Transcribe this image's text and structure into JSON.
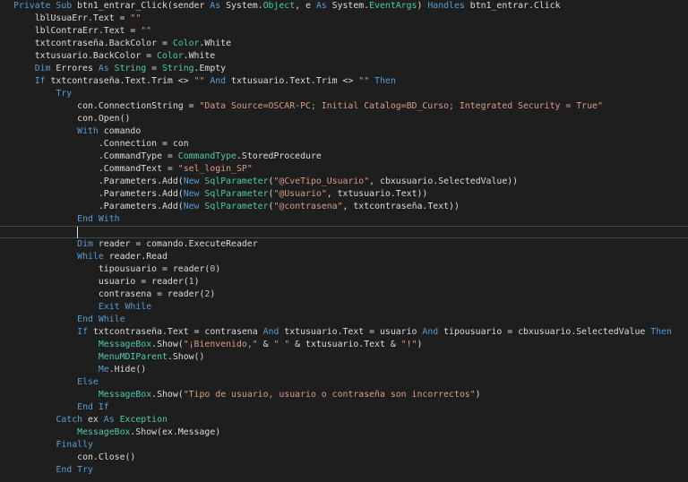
{
  "colors": {
    "background": "#1e1e1e",
    "keyword": "#569cd6",
    "type": "#4ec9b0",
    "string": "#d69d85",
    "number": "#b5cea8",
    "text": "#dcdcdc"
  },
  "current_line": 19,
  "lines": [
    {
      "indent": 0,
      "t": [
        [
          "Private Sub",
          "kw"
        ],
        [
          " btn1_entrar_Click(sender ",
          "plain"
        ],
        [
          "As",
          "kw"
        ],
        [
          " System.",
          "plain"
        ],
        [
          "Object",
          "type"
        ],
        [
          ", e ",
          "plain"
        ],
        [
          "As",
          "kw"
        ],
        [
          " System.",
          "plain"
        ],
        [
          "EventArgs",
          "type"
        ],
        [
          ") ",
          "plain"
        ],
        [
          "Handles",
          "kw"
        ],
        [
          " btn1_entrar.Click",
          "plain"
        ]
      ]
    },
    {
      "indent": 4,
      "t": [
        [
          "lblUsuaErr.Text = ",
          "plain"
        ],
        [
          "\"\"",
          "str"
        ]
      ]
    },
    {
      "indent": 4,
      "t": [
        [
          "lblContraErr.Text = ",
          "plain"
        ],
        [
          "\"\"",
          "str"
        ]
      ]
    },
    {
      "indent": 4,
      "t": [
        [
          "txtcontraseña.BackColor = ",
          "plain"
        ],
        [
          "Color",
          "type"
        ],
        [
          ".White",
          "plain"
        ]
      ]
    },
    {
      "indent": 4,
      "t": [
        [
          "txtusuario.BackColor = ",
          "plain"
        ],
        [
          "Color",
          "type"
        ],
        [
          ".White",
          "plain"
        ]
      ]
    },
    {
      "indent": 4,
      "t": [
        [
          "Dim",
          "kw"
        ],
        [
          " Errores ",
          "plain"
        ],
        [
          "As",
          "kw"
        ],
        [
          " ",
          "plain"
        ],
        [
          "String",
          "type"
        ],
        [
          " = ",
          "plain"
        ],
        [
          "String",
          "type"
        ],
        [
          ".Empty",
          "plain"
        ]
      ]
    },
    {
      "indent": 4,
      "t": [
        [
          "If",
          "kw"
        ],
        [
          " txtcontraseña.Text.Trim <> ",
          "plain"
        ],
        [
          "\"\"",
          "str"
        ],
        [
          " ",
          "plain"
        ],
        [
          "And",
          "kw"
        ],
        [
          " txtusuario.Text.Trim <> ",
          "plain"
        ],
        [
          "\"\"",
          "str"
        ],
        [
          " ",
          "plain"
        ],
        [
          "Then",
          "kw"
        ]
      ]
    },
    {
      "indent": 8,
      "t": [
        [
          "Try",
          "kw"
        ]
      ]
    },
    {
      "indent": 12,
      "t": [
        [
          "con.ConnectionString = ",
          "plain"
        ],
        [
          "\"Data Source=OSCAR-PC; Initial Catalog=BD_Curso; Integrated Security = True\"",
          "str"
        ]
      ]
    },
    {
      "indent": 12,
      "t": [
        [
          "con.Open()",
          "plain"
        ]
      ]
    },
    {
      "indent": 12,
      "t": [
        [
          "With",
          "kw"
        ],
        [
          " comando",
          "plain"
        ]
      ]
    },
    {
      "indent": 16,
      "t": [
        [
          ".Connection = con",
          "plain"
        ]
      ]
    },
    {
      "indent": 16,
      "t": [
        [
          ".CommandType = ",
          "plain"
        ],
        [
          "CommandType",
          "type"
        ],
        [
          ".StoredProcedure",
          "plain"
        ]
      ]
    },
    {
      "indent": 16,
      "t": [
        [
          ".CommandText = ",
          "plain"
        ],
        [
          "\"sel_login_SP\"",
          "str"
        ]
      ]
    },
    {
      "indent": 16,
      "t": [
        [
          ".Parameters.Add(",
          "plain"
        ],
        [
          "New",
          "kw"
        ],
        [
          " ",
          "plain"
        ],
        [
          "SqlParameter",
          "type"
        ],
        [
          "(",
          "plain"
        ],
        [
          "\"@CveTipo_Usuario\"",
          "str"
        ],
        [
          ", cbxusuario.SelectedValue))",
          "plain"
        ]
      ]
    },
    {
      "indent": 16,
      "t": [
        [
          ".Parameters.Add(",
          "plain"
        ],
        [
          "New",
          "kw"
        ],
        [
          " ",
          "plain"
        ],
        [
          "SqlParameter",
          "type"
        ],
        [
          "(",
          "plain"
        ],
        [
          "\"@Usuario\"",
          "str"
        ],
        [
          ", txtusuario.Text))",
          "plain"
        ]
      ]
    },
    {
      "indent": 16,
      "t": [
        [
          ".Parameters.Add(",
          "plain"
        ],
        [
          "New",
          "kw"
        ],
        [
          " ",
          "plain"
        ],
        [
          "SqlParameter",
          "type"
        ],
        [
          "(",
          "plain"
        ],
        [
          "\"@contrasena\"",
          "str"
        ],
        [
          ", txtcontraseña.Text))",
          "plain"
        ]
      ]
    },
    {
      "indent": 12,
      "t": [
        [
          "End With",
          "kw"
        ]
      ]
    },
    {
      "indent": 12,
      "t": []
    },
    {
      "indent": 12,
      "t": [
        [
          "Dim",
          "kw"
        ],
        [
          " reader = comando.ExecuteReader",
          "plain"
        ]
      ]
    },
    {
      "indent": 12,
      "t": [
        [
          "While",
          "kw"
        ],
        [
          " reader.Read",
          "plain"
        ]
      ]
    },
    {
      "indent": 16,
      "t": [
        [
          "tipousuario = reader(",
          "plain"
        ],
        [
          "0",
          "num"
        ],
        [
          ")",
          "plain"
        ]
      ]
    },
    {
      "indent": 16,
      "t": [
        [
          "usuario = reader(",
          "plain"
        ],
        [
          "1",
          "num"
        ],
        [
          ")",
          "plain"
        ]
      ]
    },
    {
      "indent": 16,
      "t": [
        [
          "contrasena = reader(",
          "plain"
        ],
        [
          "2",
          "num"
        ],
        [
          ")",
          "plain"
        ]
      ]
    },
    {
      "indent": 16,
      "t": [
        [
          "Exit While",
          "kw"
        ]
      ]
    },
    {
      "indent": 12,
      "t": [
        [
          "End While",
          "kw"
        ]
      ]
    },
    {
      "indent": 12,
      "t": [
        [
          "If",
          "kw"
        ],
        [
          " txtcontraseña.Text = contrasena ",
          "plain"
        ],
        [
          "And",
          "kw"
        ],
        [
          " txtusuario.Text = usuario ",
          "plain"
        ],
        [
          "And",
          "kw"
        ],
        [
          " tipousuario = cbxusuario.SelectedValue ",
          "plain"
        ],
        [
          "Then",
          "kw"
        ]
      ]
    },
    {
      "indent": 16,
      "t": [
        [
          "MessageBox",
          "type"
        ],
        [
          ".Show(",
          "plain"
        ],
        [
          "\"¡Bienvenido,\"",
          "str"
        ],
        [
          " & ",
          "plain"
        ],
        [
          "\" \"",
          "str"
        ],
        [
          " & txtusuario.Text & ",
          "plain"
        ],
        [
          "\"!\"",
          "str"
        ],
        [
          ")",
          "plain"
        ]
      ]
    },
    {
      "indent": 16,
      "t": [
        [
          "MenuMDIParent",
          "type"
        ],
        [
          ".Show()",
          "plain"
        ]
      ]
    },
    {
      "indent": 16,
      "t": [
        [
          "Me",
          "kw"
        ],
        [
          ".Hide()",
          "plain"
        ]
      ]
    },
    {
      "indent": 12,
      "t": [
        [
          "Else",
          "kw"
        ]
      ]
    },
    {
      "indent": 16,
      "t": [
        [
          "MessageBox",
          "type"
        ],
        [
          ".Show(",
          "plain"
        ],
        [
          "\"Tipo de usuario, usuario o contraseña son incorrectos\"",
          "str"
        ],
        [
          ")",
          "plain"
        ]
      ]
    },
    {
      "indent": 12,
      "t": [
        [
          "End If",
          "kw"
        ]
      ]
    },
    {
      "indent": 8,
      "t": [
        [
          "Catch",
          "kw"
        ],
        [
          " ex ",
          "plain"
        ],
        [
          "As",
          "kw"
        ],
        [
          " ",
          "plain"
        ],
        [
          "Exception",
          "type"
        ]
      ]
    },
    {
      "indent": 12,
      "t": [
        [
          "MessageBox",
          "type"
        ],
        [
          ".Show(ex.Message)",
          "plain"
        ]
      ]
    },
    {
      "indent": 8,
      "t": [
        [
          "Finally",
          "kw"
        ]
      ]
    },
    {
      "indent": 12,
      "t": [
        [
          "con.Close()",
          "plain"
        ]
      ]
    },
    {
      "indent": 8,
      "t": [
        [
          "End Try",
          "kw"
        ]
      ]
    }
  ]
}
